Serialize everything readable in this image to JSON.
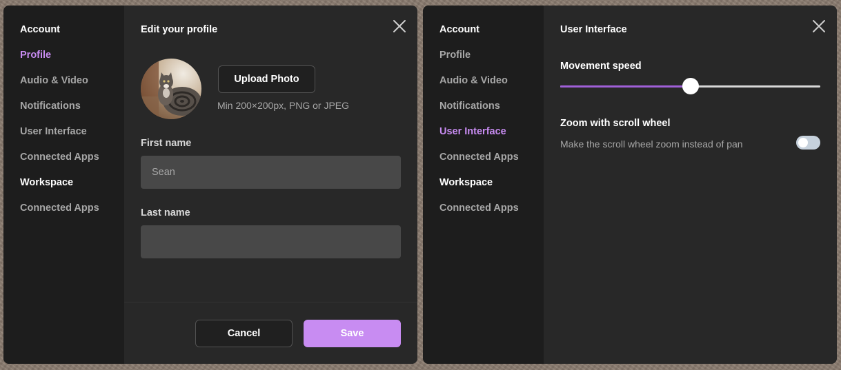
{
  "left_dialog": {
    "sidebar": {
      "account_heading": "Account",
      "items": [
        {
          "label": "Profile",
          "active": true
        },
        {
          "label": "Audio & Video",
          "active": false
        },
        {
          "label": "Notifications",
          "active": false
        },
        {
          "label": "User Interface",
          "active": false
        },
        {
          "label": "Connected Apps",
          "active": false
        }
      ],
      "workspace_heading": "Workspace",
      "workspace_items": [
        {
          "label": "Connected Apps",
          "active": false
        }
      ]
    },
    "title": "Edit your profile",
    "close_icon": "close-icon",
    "upload_button": "Upload Photo",
    "upload_hint": "Min 200×200px, PNG or JPEG",
    "first_name_label": "First name",
    "first_name_value": "Sean",
    "last_name_label": "Last name",
    "last_name_value": "",
    "cancel_label": "Cancel",
    "save_label": "Save"
  },
  "right_dialog": {
    "sidebar": {
      "account_heading": "Account",
      "items": [
        {
          "label": "Profile",
          "active": false
        },
        {
          "label": "Audio & Video",
          "active": false
        },
        {
          "label": "Notifications",
          "active": false
        },
        {
          "label": "User Interface",
          "active": true
        },
        {
          "label": "Connected Apps",
          "active": false
        }
      ],
      "workspace_heading": "Workspace",
      "workspace_items": [
        {
          "label": "Connected Apps",
          "active": false
        }
      ]
    },
    "title": "User Interface",
    "close_icon": "close-icon",
    "movement_speed_label": "Movement speed",
    "movement_speed_fraction": 0.5,
    "zoom_label": "Zoom with scroll wheel",
    "zoom_description": "Make the scroll wheel zoom instead of pan",
    "zoom_enabled": false
  },
  "colors": {
    "accent": "#c88cf2",
    "slider_fill": "#a060d8",
    "sidebar_bg": "#1d1d1d",
    "panel_bg": "#282828"
  }
}
